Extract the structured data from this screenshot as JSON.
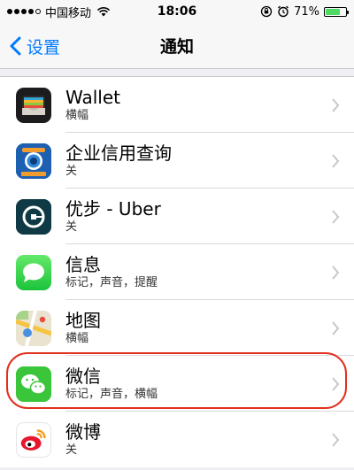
{
  "status_bar": {
    "carrier": "中国移动",
    "time": "18:06",
    "battery": "71%",
    "battery_level": 0.71
  },
  "nav": {
    "back_label": "设置",
    "title": "通知"
  },
  "items": [
    {
      "title": "Wallet",
      "subtitle": "横幅",
      "icon": "wallet-icon"
    },
    {
      "title": "企业信用查询",
      "subtitle": "关",
      "icon": "credit-query-icon"
    },
    {
      "title": "优步 - Uber",
      "subtitle": "关",
      "icon": "uber-icon"
    },
    {
      "title": "信息",
      "subtitle": "标记，声音，提醒",
      "icon": "messages-icon"
    },
    {
      "title": "地图",
      "subtitle": "横幅",
      "icon": "maps-icon"
    },
    {
      "title": "微信",
      "subtitle": "标记，声音，横幅",
      "icon": "wechat-icon",
      "highlighted": true
    },
    {
      "title": "微博",
      "subtitle": "关",
      "icon": "weibo-icon"
    }
  ],
  "colors": {
    "accent": "#007aff",
    "highlight": "#e0301e",
    "battery": "#4cd964"
  }
}
